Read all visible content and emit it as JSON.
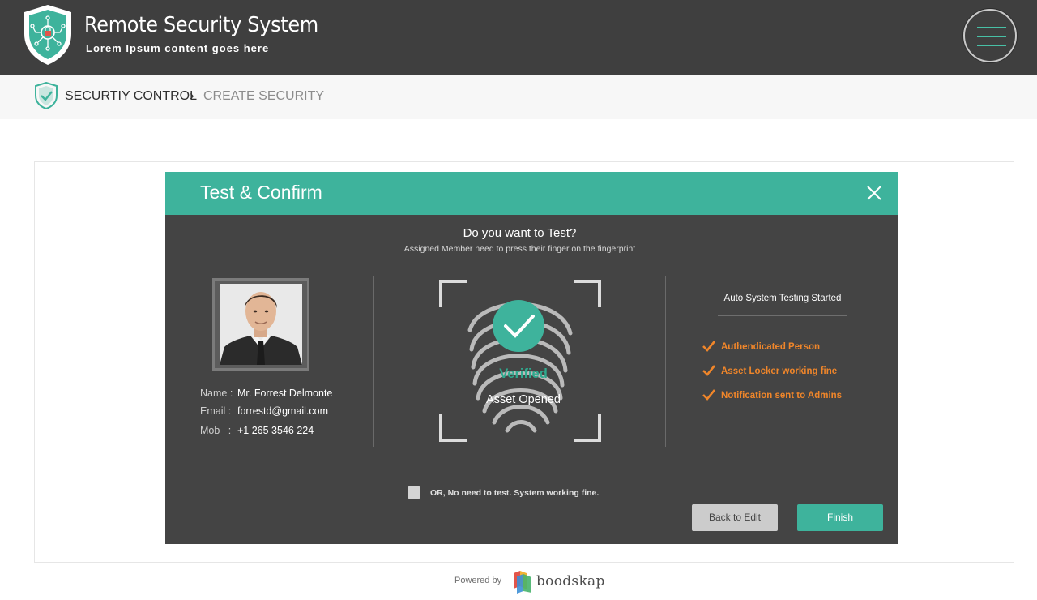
{
  "header": {
    "title": "Remote Security System",
    "subtitle": "Lorem Ipsum content goes here",
    "menu_icon": "hamburger-icon"
  },
  "breadcrumb": {
    "section": "SECURTIY CONTROL",
    "current": "CREATE SECURITY"
  },
  "modal": {
    "title": "Test & Confirm",
    "question": "Do you want to Test?",
    "instruction": "Assigned Member need to press their finger on the fingerprint",
    "person": {
      "name_label": "Name :",
      "name": "Mr. Forrest Delmonte",
      "email_label": "Email :",
      "email": "forrestd@gmail.com",
      "mob_label": "Mob   :",
      "mob": "+1 265 3546 224"
    },
    "scan": {
      "status": "Verified",
      "result": "Asset Opened"
    },
    "auto_test": {
      "title": "Auto System Testing Started",
      "items": [
        "Authendicated Person",
        "Asset Locker working fine",
        "Notification sent to Admins"
      ]
    },
    "skip_label": "OR, No need to test. System working fine.",
    "back_label": "Back to Edit",
    "finish_label": "Finish"
  },
  "footer": {
    "powered_by": "Powered by",
    "brand": "boodskap"
  },
  "colors": {
    "header_bg": "#3f3f3f",
    "accent": "#3eb39c",
    "modal_bg": "#444444",
    "check": "#f0862a"
  }
}
